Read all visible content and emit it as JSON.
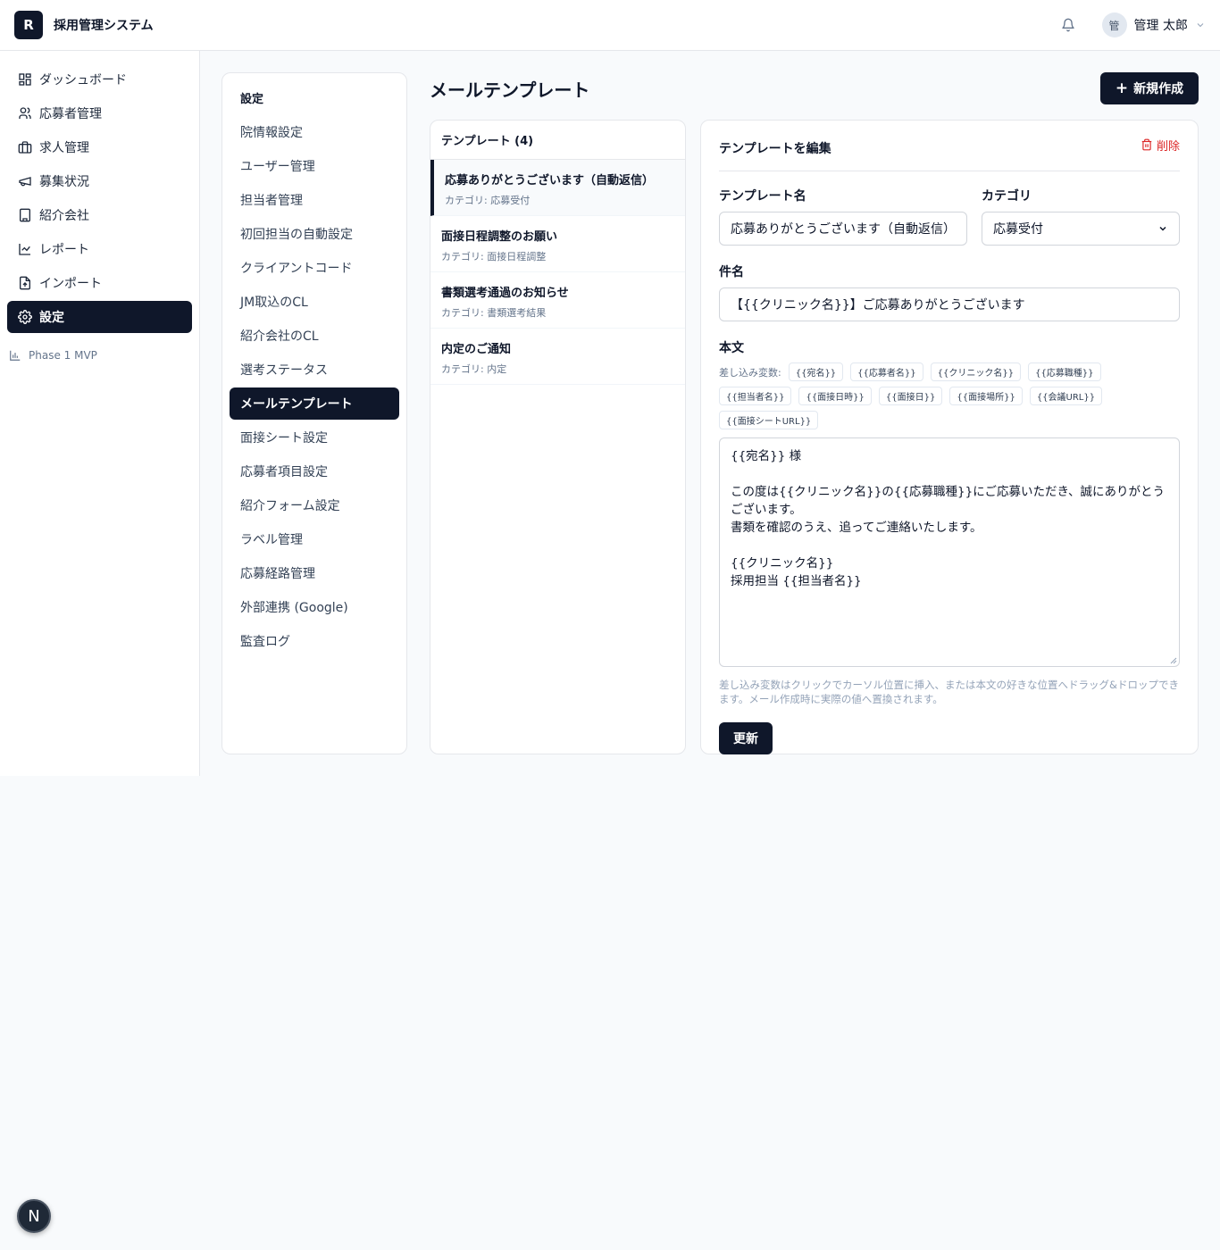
{
  "header": {
    "logo_letter": "R",
    "app_title": "採用管理システム",
    "avatar_initial": "管",
    "user_name": "管理 太郎"
  },
  "sidebar": {
    "items": [
      {
        "label": "ダッシュボード",
        "icon": "grid-icon"
      },
      {
        "label": "応募者管理",
        "icon": "users-icon"
      },
      {
        "label": "求人管理",
        "icon": "briefcase-icon"
      },
      {
        "label": "募集状況",
        "icon": "megaphone-icon"
      },
      {
        "label": "紹介会社",
        "icon": "building-icon"
      },
      {
        "label": "レポート",
        "icon": "chart-line-icon"
      },
      {
        "label": "インポート",
        "icon": "file-import-icon"
      },
      {
        "label": "設定",
        "icon": "gear-icon",
        "active": true
      }
    ],
    "phase_label": "Phase 1 MVP"
  },
  "settings_menu": {
    "heading": "設定",
    "items": [
      "院情報設定",
      "ユーザー管理",
      "担当者管理",
      "初回担当の自動設定",
      "クライアントコード",
      "JM取込のCL",
      "紹介会社のCL",
      "選考ステータス",
      "メールテンプレート",
      "面接シート設定",
      "応募者項目設定",
      "紹介フォーム設定",
      "ラベル管理",
      "応募経路管理",
      "外部連携 (Google)",
      "監査ログ"
    ],
    "active_index": 8
  },
  "page": {
    "title": "メールテンプレート",
    "new_button": "新規作成"
  },
  "template_list": {
    "header": "テンプレート (4)",
    "items": [
      {
        "name": "応募ありがとうございます（自動返信）",
        "category": "カテゴリ: 応募受付",
        "active": true
      },
      {
        "name": "面接日程調整のお願い",
        "category": "カテゴリ: 面接日程調整"
      },
      {
        "name": "書類選考通過のお知らせ",
        "category": "カテゴリ: 書類選考結果"
      },
      {
        "name": "内定のご通知",
        "category": "カテゴリ: 内定"
      }
    ]
  },
  "editor": {
    "title": "テンプレートを編集",
    "delete_label": "削除",
    "name_label": "テンプレート名",
    "name_value": "応募ありがとうございます（自動返信）",
    "category_label": "カテゴリ",
    "category_value": "応募受付",
    "subject_label": "件名",
    "subject_value": "【{{クリニック名}}】ご応募ありがとうございます",
    "body_label": "本文",
    "vars_label": "差し込み変数:",
    "variables": [
      "{{宛名}}",
      "{{応募者名}}",
      "{{クリニック名}}",
      "{{応募職種}}",
      "{{担当者名}}",
      "{{面接日時}}",
      "{{面接日}}",
      "{{面接場所}}",
      "{{会議URL}}",
      "{{面接シートURL}}"
    ],
    "body_value": "{{宛名}} 様\n\nこの度は{{クリニック名}}の{{応募職種}}にご応募いただき、誠にありがとうございます。\n書類を確認のうえ、追ってご連絡いたします。\n\n{{クリニック名}}\n採用担当 {{担当者名}}",
    "hint": "差し込み変数はクリックでカーソル位置に挿入、または本文の好きな位置へドラッグ&ドロップできます。メール作成時に実際の値へ置換されます。",
    "update_button": "更新"
  },
  "dev_badge": "N",
  "colors": {
    "primary": "#0f172a",
    "danger": "#dc2626",
    "background": "#f8fafc",
    "border": "#e5e7eb"
  }
}
